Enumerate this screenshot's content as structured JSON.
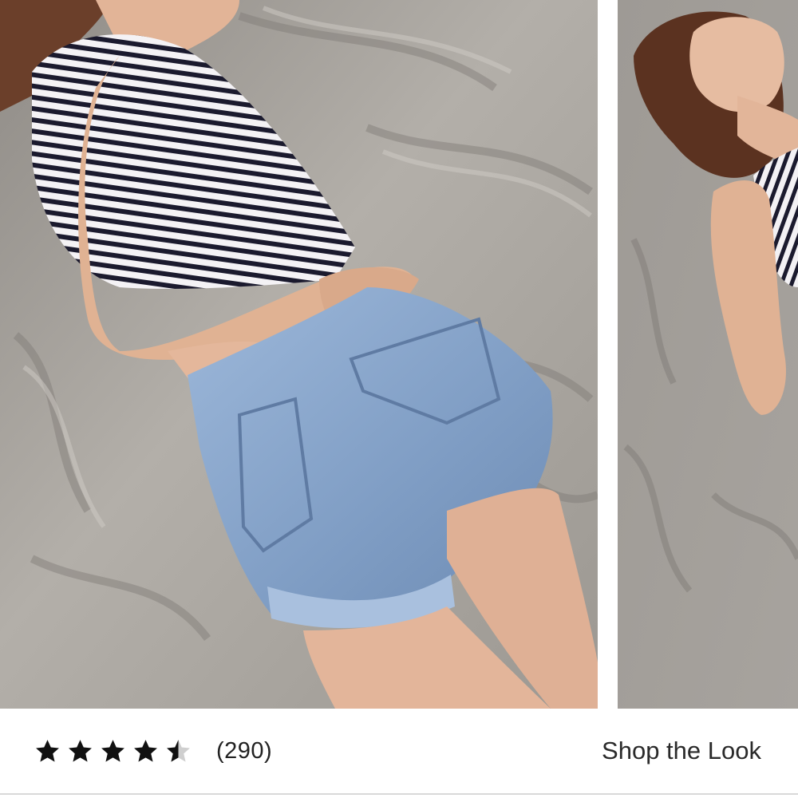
{
  "carousel": {
    "slides": [
      {
        "description_icon": "photo-model-lying-on-sand-back"
      },
      {
        "description_icon": "photo-model-lying-on-sand-face"
      }
    ]
  },
  "rating": {
    "value": 4.5,
    "max": 5,
    "count_text": "(290)",
    "star_color": "#111111",
    "empty_star_color": "#cfcfcf"
  },
  "links": {
    "shop_the_look": "Shop the Look"
  },
  "colors": {
    "sand": "#a8a49f",
    "denim": "#7f9dc4",
    "background": "#ffffff"
  }
}
